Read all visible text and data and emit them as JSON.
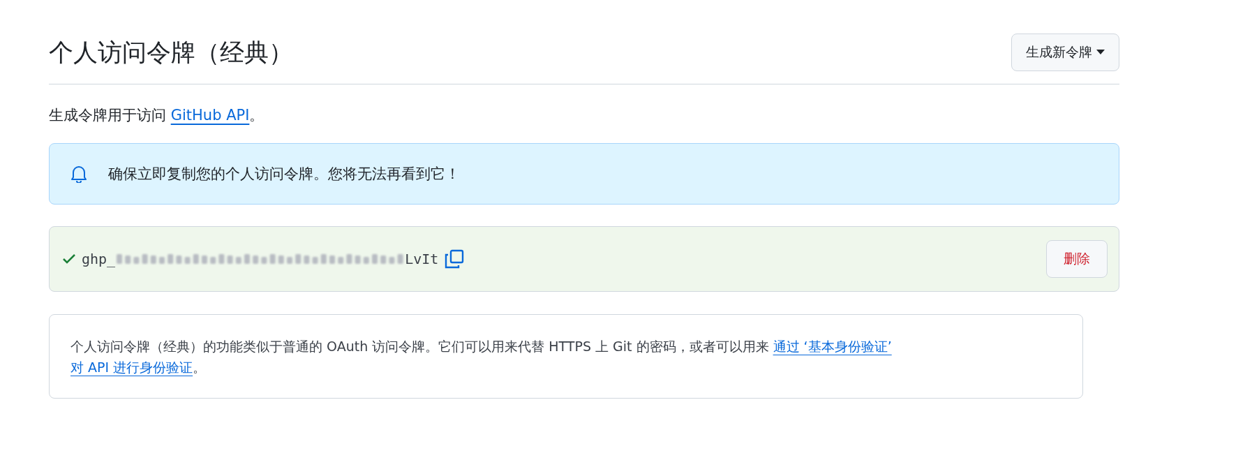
{
  "header": {
    "title": "个人访问令牌（经典）",
    "button": "生成新令牌"
  },
  "intro": {
    "text": "生成令牌用于访问 ",
    "link": "GitHub API",
    "end": "。"
  },
  "flash": {
    "text": "确保立即复制您的个人访问令牌。您将无法再看到它！"
  },
  "token": {
    "prefix": "ghp_",
    "suffix": "LvIt",
    "verified": true,
    "delete_button": "删除"
  },
  "info": {
    "text": "个人访问令牌（经典）的功能类似于普通的 OAuth 访问令牌。它们可以用来代替 HTTPS 上 Git 的密码，或者可以用来 ",
    "link_1": "通过 ‘基本身份验证’",
    "link_2": "对 API 进行身份验证",
    "end": "。"
  }
}
